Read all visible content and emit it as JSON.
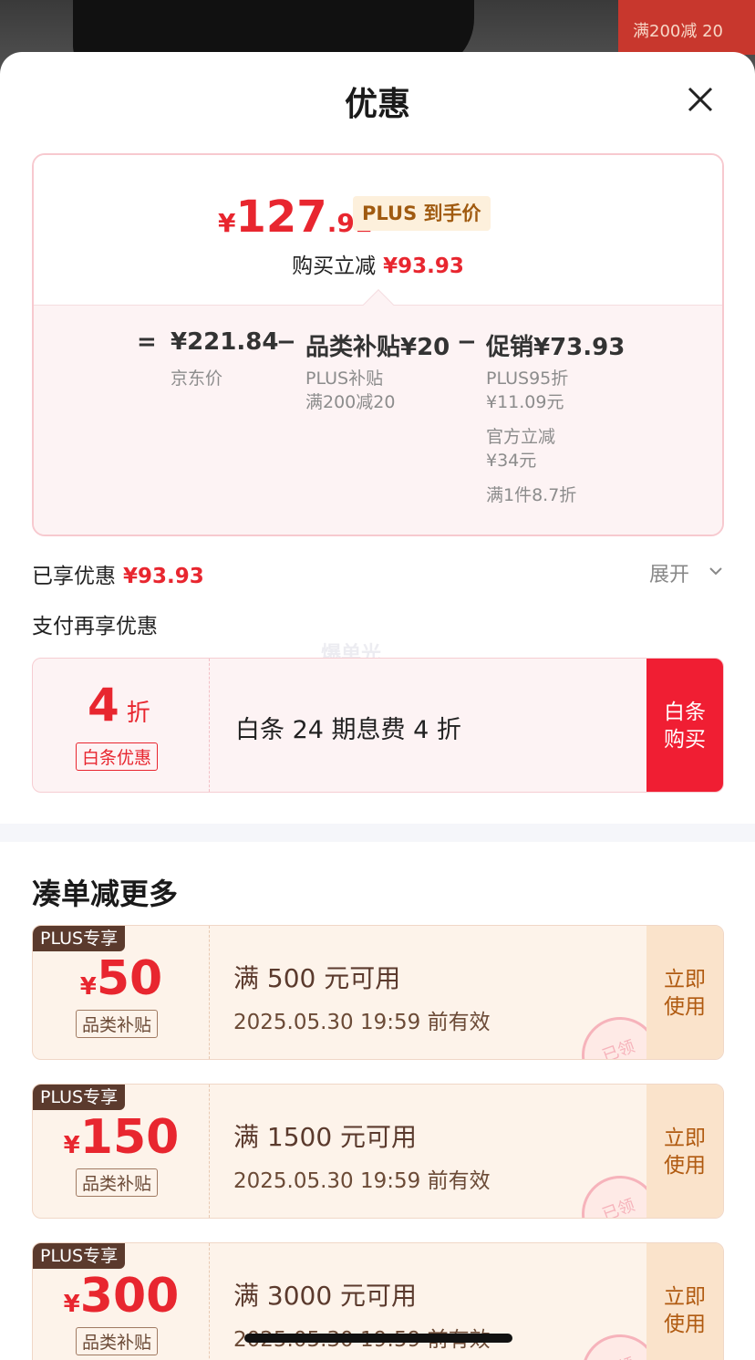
{
  "peek": {
    "tag_text": "满200减 20"
  },
  "header": {
    "title": "优惠"
  },
  "price_card": {
    "currency": "¥",
    "price_int": "127",
    "price_dec": ".91",
    "plus_badge": "PLUS 到手价",
    "reduce_label": "购买立减",
    "reduce_amount": "¥93.93",
    "eq_sign": "=",
    "minus_sign": "−",
    "jd_price": "¥221.84",
    "jd_price_label": "京东价",
    "category_subsidy": "品类补贴¥20",
    "category_sub_1": "PLUS补贴",
    "category_sub_2": "满200减20",
    "promo": "促销¥73.93",
    "promo_sub_1": "PLUS95折",
    "promo_sub_2": "¥11.09元",
    "promo_sub_3": "官方立减",
    "promo_sub_4": "¥34元",
    "promo_sub_5": "满1件8.7折"
  },
  "enjoyed": {
    "label": "已享优惠",
    "amount": "¥93.93",
    "expand": "展开"
  },
  "pay": {
    "title": "支付再享优惠",
    "watermark": "爆单光"
  },
  "baitiao": {
    "discount_num": "4",
    "discount_unit": "折",
    "tag": "白条优惠",
    "desc": "白条 24 期息费 4 折",
    "button_line1": "白条",
    "button_line2": "购买"
  },
  "section": {
    "title": "凑单减更多"
  },
  "coupons": [
    {
      "badge": "PLUS专享",
      "currency": "¥",
      "amount": "50",
      "tag": "品类补贴",
      "condition": "满 500 元可用",
      "validity": "2025.05.30 19:59 前有效",
      "button_line1": "立即",
      "button_line2": "使用",
      "stamp": "已领"
    },
    {
      "badge": "PLUS专享",
      "currency": "¥",
      "amount": "150",
      "tag": "品类补贴",
      "condition": "满 1500 元可用",
      "validity": "2025.05.30 19:59 前有效",
      "button_line1": "立即",
      "button_line2": "使用",
      "stamp": "已领"
    },
    {
      "badge": "PLUS专享",
      "currency": "¥",
      "amount": "300",
      "tag": "品类补贴",
      "condition": "满 3000 元可用",
      "validity": "2025.05.30 19:59 前有效",
      "button_line1": "立即",
      "button_line2": "使用",
      "stamp": "已领"
    }
  ],
  "colors": {
    "accent_red": "#e8262f",
    "button_red": "#f01e33",
    "coupon_bg": "#fdf3ea",
    "plus_brown": "#5b3a2d"
  }
}
